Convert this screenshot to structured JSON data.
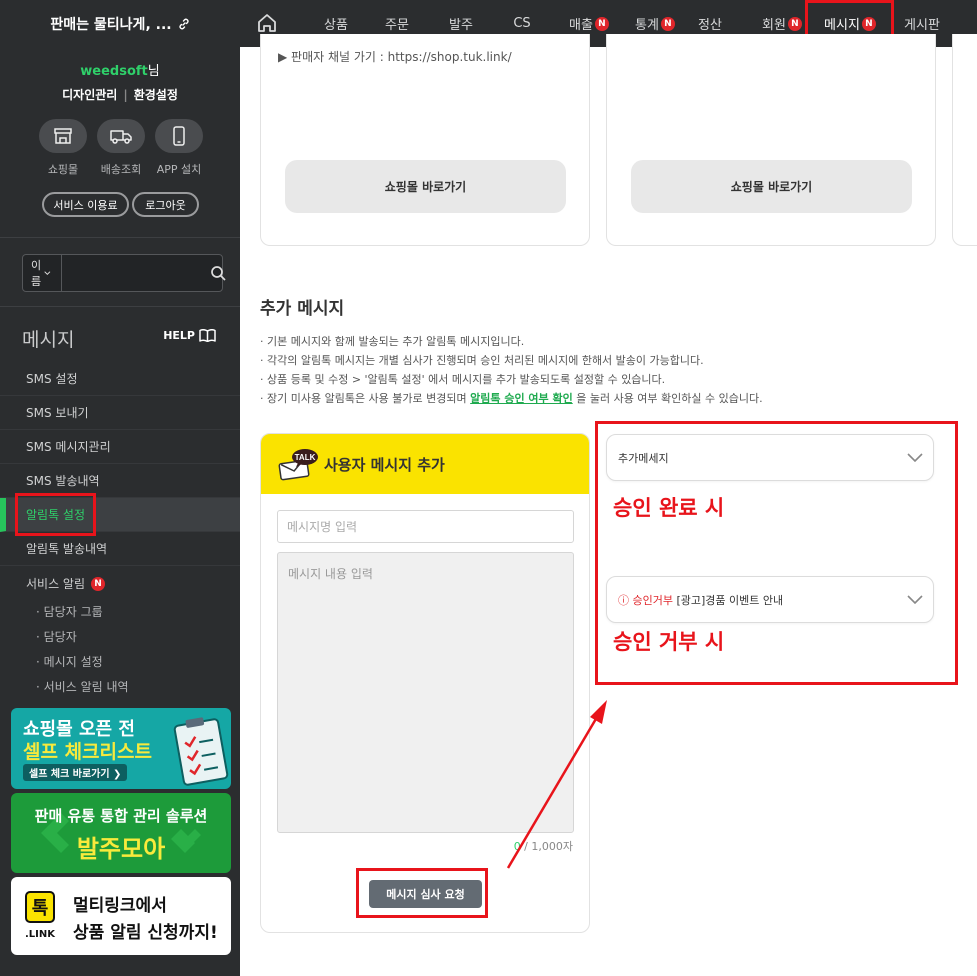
{
  "brand": {
    "title": "판매는 물티나게, ..."
  },
  "nav": [
    {
      "label": "상품"
    },
    {
      "label": "주문"
    },
    {
      "label": "발주"
    },
    {
      "label": "CS"
    },
    {
      "label": "매출",
      "badge": "N"
    },
    {
      "label": "통계",
      "badge": "N"
    },
    {
      "label": "정산"
    },
    {
      "label": "회원",
      "badge": "N"
    },
    {
      "label": "메시지",
      "badge": "N",
      "active": true
    },
    {
      "label": "게시판"
    }
  ],
  "sidebar": {
    "user_name": "weedsoft",
    "user_suffix": "님",
    "link_design": "디자인관리",
    "link_settings": "환경설정",
    "quick": [
      {
        "label": "쇼핑몰",
        "icon": "store-icon"
      },
      {
        "label": "배송조회",
        "icon": "truck-icon"
      },
      {
        "label": "APP 설치",
        "icon": "phone-icon"
      }
    ],
    "service_btn": "서비스 이용료",
    "logout_btn": "로그아웃",
    "search_select": "이름",
    "section_title": "메시지",
    "help": "HELP",
    "menu": [
      {
        "label": "SMS 설정"
      },
      {
        "label": "SMS 보내기"
      },
      {
        "label": "SMS 메시지관리"
      },
      {
        "label": "SMS 발송내역"
      },
      {
        "label": "알림톡 설정",
        "active": true
      },
      {
        "label": "알림톡 발송내역"
      }
    ],
    "service_alarm": "서비스 알림",
    "service_alarm_badge": "N",
    "sub_menu": [
      "· 담당자 그룹",
      "· 담당자",
      "· 메시지 설정",
      "· 서비스 알림 내역"
    ],
    "banner1": {
      "line1": "쇼핑몰 오픈 전",
      "line2": "셀프 체크리스트",
      "cta": "셀프 체크 바로가기 ❯"
    },
    "banner2": {
      "line1": "판매 유통 통합 관리 솔루션",
      "line2": "발주모아"
    },
    "banner3": {
      "logo_mark": "톡",
      "logo_sub": ".LINK",
      "line1": "멀티링크에서",
      "line2": "상품 알림 신청까지!"
    }
  },
  "cards": {
    "text": "▶ 판매자 채널 가기 : https://shop.tuk.link/",
    "btn1": "쇼핑몰 바로가기",
    "btn2": "쇼핑몰 바로가기"
  },
  "extra": {
    "title": "추가 메시지",
    "desc1": "· 기본 메시지와 함께 발송되는 추가 알림톡 메시지입니다.",
    "desc2": "· 각각의 알림톡 메시지는 개별 심사가 진행되며 승인 처리된 메시지에 한해서 발송이 가능합니다.",
    "desc3": "· 상품 등록 및 수정 > '알림톡 설정' 에서 메시지를 추가 발송되도록 설정할 수 있습니다.",
    "desc4_pre": "· 장기 미사용 알림톡은 사용 불가로 변경되며 ",
    "desc4_link": "알림톡 승인 여부 확인",
    "desc4_post": " 을 눌러 사용 여부 확인하실 수 있습니다."
  },
  "compose": {
    "talk_badge": "TALK",
    "title": "사용자 메시지 추가",
    "name_placeholder": "메시지명 입력",
    "body_placeholder": "메시지 내용 입력",
    "count": "0",
    "count_max": " / 1,000자",
    "submit": "메시지 심사 요청"
  },
  "dropdowns": {
    "approved": "추가메세지",
    "rejected_status": "ⓘ 승인거부",
    "rejected_label": "[광고]경품 이벤트 안내"
  },
  "annotations": {
    "approved": "승인 완료 시",
    "rejected": "승인 거부 시"
  },
  "colors": {
    "accent_green": "#27c55c",
    "annotation_red": "#e8141b",
    "kakao_yellow": "#fae300",
    "sidebar_bg": "#2b2d2f"
  }
}
